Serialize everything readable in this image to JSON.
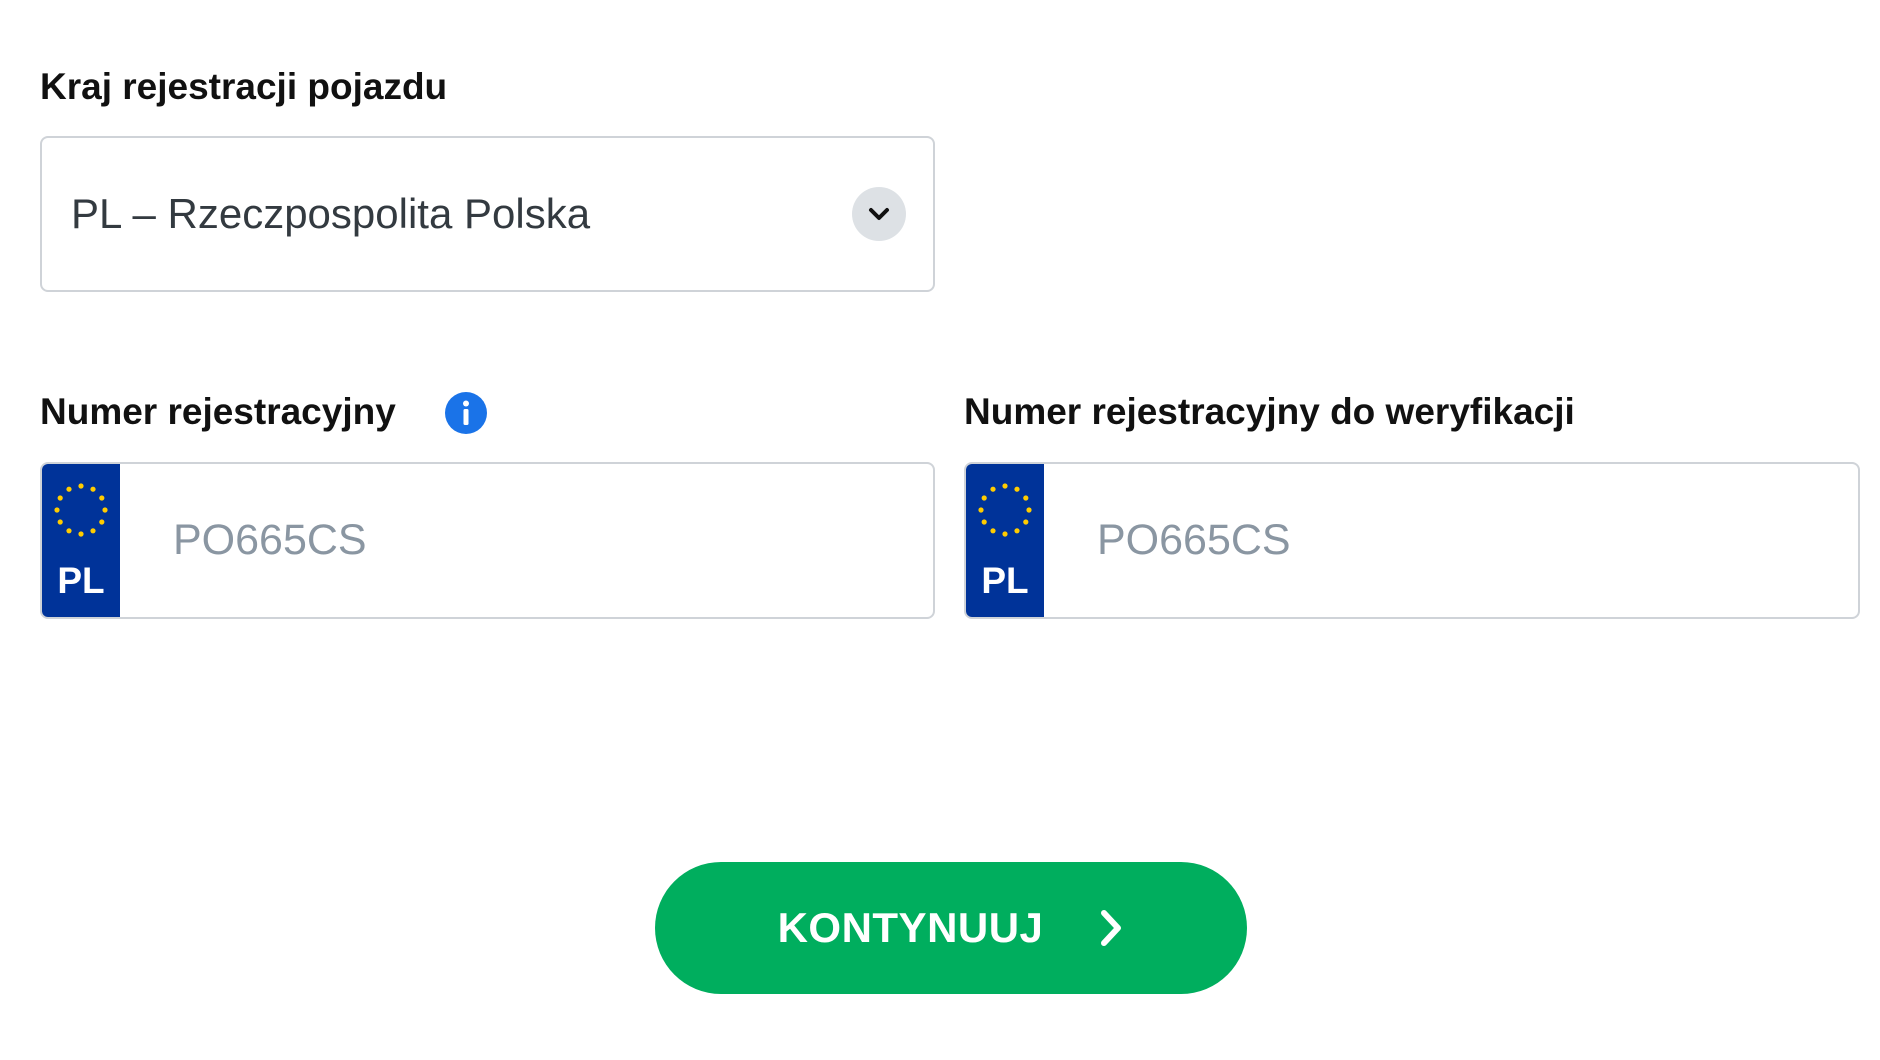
{
  "country": {
    "label": "Kraj rejestracji pojazdu",
    "selected": "PL – Rzeczpospolita Polska"
  },
  "plate": {
    "label": "Numer rejestracyjny",
    "info_icon": "info-icon",
    "country_code": "PL",
    "placeholder": "PO665CS"
  },
  "plate_verify": {
    "label": "Numer rejestracyjny do weryfikacji",
    "country_code": "PL",
    "placeholder": "PO665CS"
  },
  "continue_button": {
    "label": "KONTYNUUJ",
    "icon": "chevron-right-icon"
  },
  "colors": {
    "eu_blue": "#003399",
    "eu_star": "#ffcc00",
    "accent_green": "#00ae5e",
    "info_blue": "#1a73e8"
  }
}
